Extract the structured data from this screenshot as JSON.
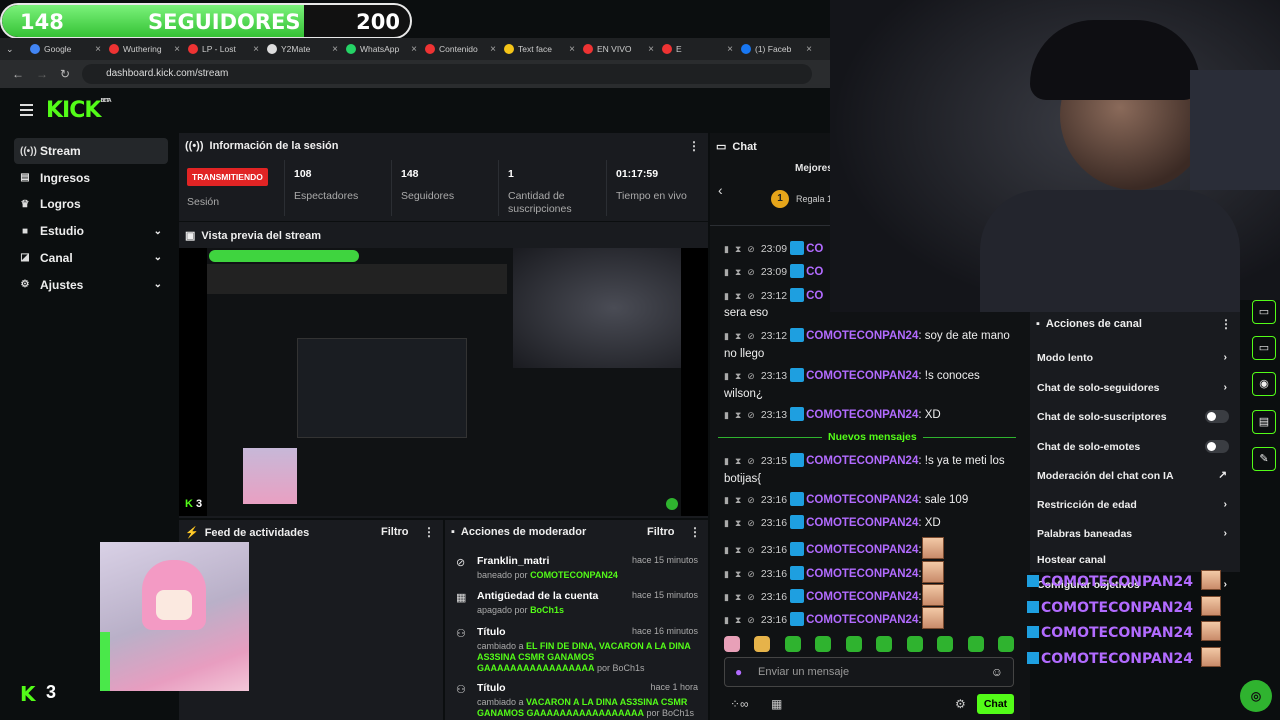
{
  "goal": {
    "current": "148",
    "label": "SEGUIDORES",
    "target": "200",
    "progress_fraction": 0.74
  },
  "browser": {
    "tabs": [
      {
        "label": "Google",
        "color": "#4285f4"
      },
      {
        "label": "Wuthering",
        "color": "#e33"
      },
      {
        "label": "LP - Lost",
        "color": "#e33"
      },
      {
        "label": "Y2Mate",
        "color": "#ddd"
      },
      {
        "label": "WhatsApp",
        "color": "#25d366"
      },
      {
        "label": "Contenido",
        "color": "#e33"
      },
      {
        "label": "Text face",
        "color": "#f5c518"
      },
      {
        "label": "EN VIVO",
        "color": "#e33"
      },
      {
        "label": "E",
        "color": "#e33"
      },
      {
        "label": "(1) Faceb",
        "color": "#1877f2"
      }
    ],
    "url": "dashboard.kick.com/stream"
  },
  "brand": {
    "logo": "KICK",
    "beta": "BETA",
    "accent": "#53fc18"
  },
  "sidebar": {
    "items": [
      {
        "label": "Stream",
        "icon": "broadcast-icon"
      },
      {
        "label": "Ingresos",
        "icon": "wallet-icon"
      },
      {
        "label": "Logros",
        "icon": "trophy-icon"
      },
      {
        "label": "Estudio",
        "icon": "studio-icon"
      },
      {
        "label": "Canal",
        "icon": "channel-icon"
      },
      {
        "label": "Ajustes",
        "icon": "gear-icon"
      }
    ],
    "bottom_badge": "3"
  },
  "session": {
    "title": "Información de la sesión",
    "status_badge": "TRANSMITIENDO",
    "status_label": "Sesión",
    "stats": [
      {
        "value": "108",
        "label": "Espectadores"
      },
      {
        "value": "148",
        "label": "Seguidores"
      },
      {
        "value": "1",
        "label": "Cantidad de suscripciones"
      },
      {
        "value": "01:17:59",
        "label": "Tiempo en vivo"
      }
    ]
  },
  "preview": {
    "title": "Vista previa del stream",
    "viewer_count": "3"
  },
  "activity": {
    "title": "Feed de actividades",
    "filter": "Filtro"
  },
  "mod_actions": {
    "title": "Acciones de moderador",
    "filter": "Filtro",
    "rows": [
      {
        "title": "Franklin_matri",
        "prefix": "baneado por",
        "by": "COMOTECONPAN24",
        "suffix": "",
        "time": "hace 15 minutos"
      },
      {
        "title": "Antigüedad de la cuenta",
        "prefix": "apagado por",
        "by": "BoCh1s",
        "suffix": "",
        "time": "hace 15 minutos"
      },
      {
        "title": "Título",
        "prefix": "cambiado a",
        "by": "EL FIN DE DINA, VACARON A LA DINA AS3SINA CSMR GANAMOS GAAAAAAAAAAAAAAAAA",
        "suffix": "por BoCh1s",
        "time": "hace 16 minutos"
      },
      {
        "title": "Título",
        "prefix": "cambiado a",
        "by": "VACARON A LA DINA AS3SINA CSMR GANAMOS GAAAAAAAAAAAAAAAAA",
        "suffix": "por BoCh1s",
        "time": "hace 1 hora"
      }
    ]
  },
  "chat": {
    "title": "Chat",
    "leaderboard_label": "Mejores",
    "gift_label": "Regala 1",
    "messages": [
      {
        "time": "23:09",
        "user": "CO",
        "text": ""
      },
      {
        "time": "23:09",
        "user": "CO",
        "text": ""
      },
      {
        "time": "23:12",
        "user": "CO",
        "text": ""
      },
      {
        "time": "",
        "user": "",
        "text": "sera eso"
      },
      {
        "time": "23:12",
        "user": "COMOTECONPAN24",
        "text": ": soy de ate mano no llego"
      },
      {
        "time": "23:13",
        "user": "COMOTECONPAN24",
        "text": ": !s conoces wilson¿"
      },
      {
        "time": "23:13",
        "user": "COMOTECONPAN24",
        "text": ": XD"
      },
      {
        "time": "23:15",
        "user": "COMOTECONPAN24",
        "text": ": !s ya te meti los botijas{"
      },
      {
        "time": "23:16",
        "user": "COMOTECONPAN24",
        "text": ": sale 109"
      },
      {
        "time": "23:16",
        "user": "COMOTECONPAN24",
        "text": ": XD"
      },
      {
        "time": "23:16",
        "user": "COMOTECONPAN24",
        "text": ":"
      },
      {
        "time": "23:16",
        "user": "COMOTECONPAN24",
        "text": ":"
      },
      {
        "time": "23:16",
        "user": "COMOTECONPAN24",
        "text": ":"
      },
      {
        "time": "23:16",
        "user": "COMOTECONPAN24",
        "text": ":"
      }
    ],
    "new_messages": "Nuevos mensajes",
    "input_placeholder": "Enviar un mensaje",
    "send_label": "Chat"
  },
  "channel_actions": {
    "title": "Acciones de canal",
    "items": [
      {
        "label": "Modo lento",
        "control": "chevron"
      },
      {
        "label": "Chat de solo-seguidores",
        "control": "chevron"
      },
      {
        "label": "Chat de solo-suscriptores",
        "control": "toggle"
      },
      {
        "label": "Chat de solo-emotes",
        "control": "toggle"
      },
      {
        "label": "Moderación del chat con IA",
        "control": "external"
      },
      {
        "label": "Restricción de edad",
        "control": "chevron"
      },
      {
        "label": "Palabras baneadas",
        "control": "chevron"
      },
      {
        "label": "Hostear canal",
        "control": "none"
      },
      {
        "label": "Configurar objetivos",
        "control": "chevron"
      }
    ]
  },
  "overlay_names": [
    "COMOTECONPAN24",
    "COMOTECONPAN24",
    "COMOTECONPAN24",
    "COMOTECONPAN24"
  ]
}
